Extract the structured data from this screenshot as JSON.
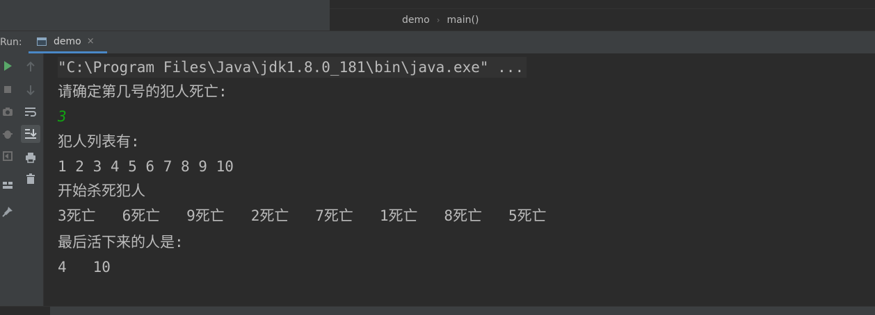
{
  "breadcrumb": {
    "file": "demo",
    "method": "main()"
  },
  "run_panel": {
    "label": "Run:",
    "tab_label": "demo",
    "tab_close": "×"
  },
  "console": {
    "lines": [
      "\"C:\\Program Files\\Java\\jdk1.8.0_181\\bin\\java.exe\" ...",
      "请确定第几号的犯人死亡:",
      "3",
      "犯人列表有:",
      "1 2 3 4 5 6 7 8 9 10",
      "开始杀死犯人",
      "3死亡   6死亡   9死亡   2死亡   7死亡   1死亡   8死亡   5死亡",
      "最后活下来的人是:",
      "4   10"
    ]
  },
  "colors": {
    "input_text": "#12a412",
    "tab_underline": "#4a88c7"
  }
}
